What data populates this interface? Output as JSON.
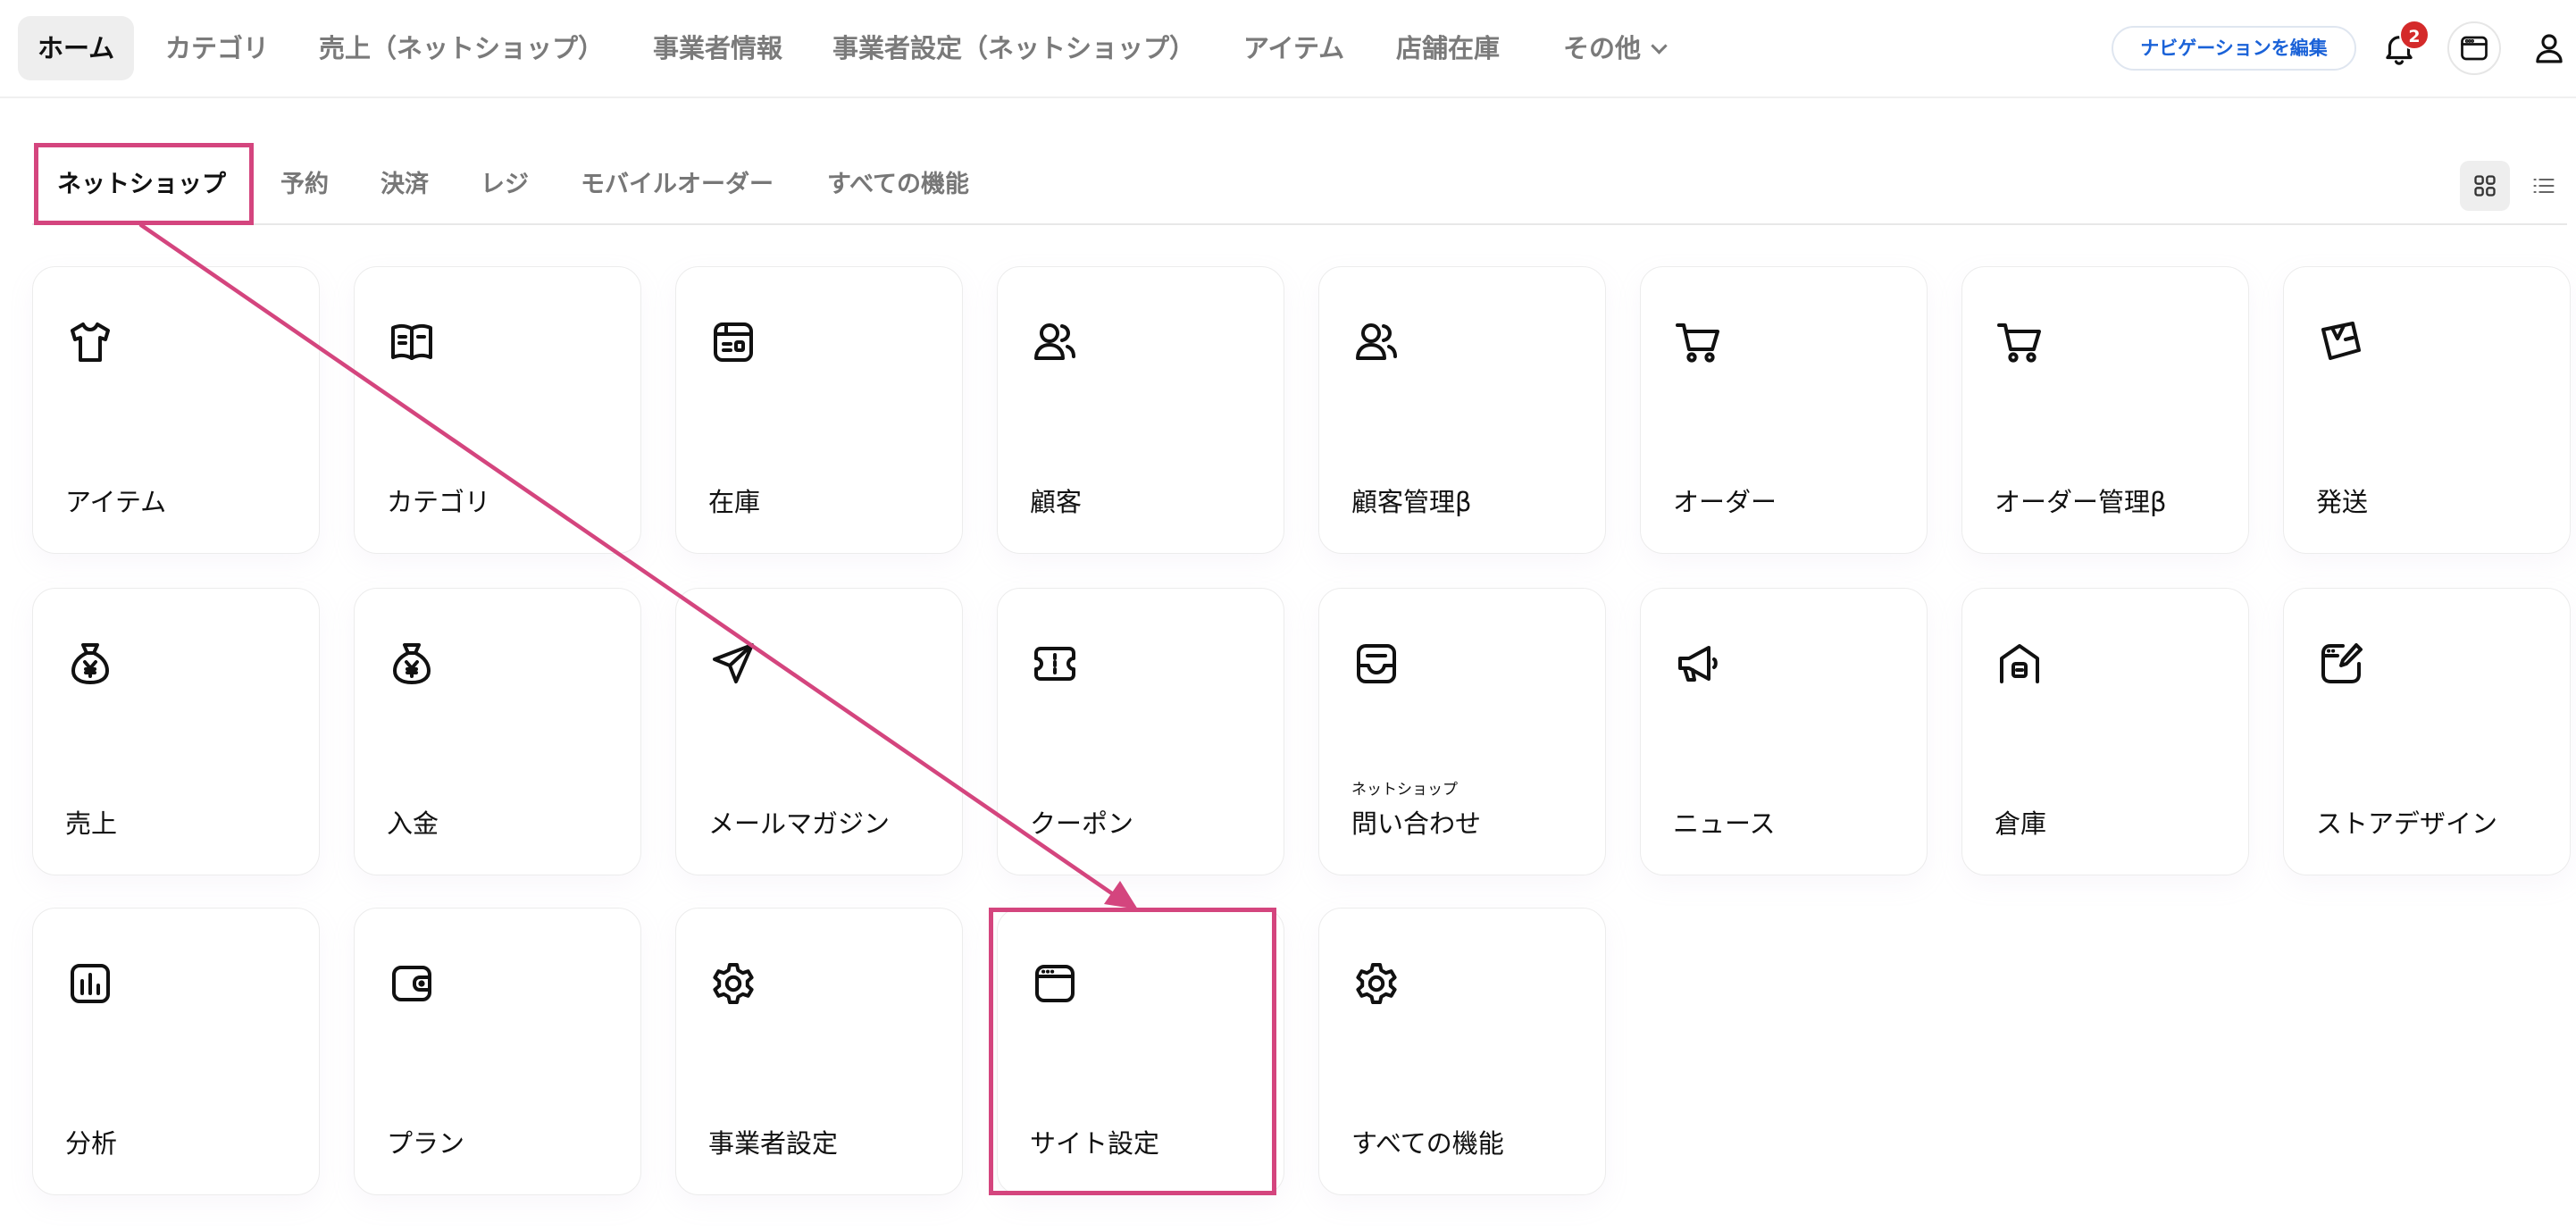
{
  "topnav": {
    "items": [
      {
        "label": "ホーム",
        "active": true
      },
      {
        "label": "カテゴリ"
      },
      {
        "label": "売上（ネットショップ）"
      },
      {
        "label": "事業者情報"
      },
      {
        "label": "事業者設定（ネットショップ）"
      },
      {
        "label": "アイテム"
      },
      {
        "label": "店舗在庫"
      },
      {
        "label": "その他"
      }
    ],
    "edit_nav_label": "ナビゲーションを編集",
    "notification_count": "2",
    "icons": [
      "bell-icon",
      "site-window-icon",
      "user-icon"
    ]
  },
  "subtabs": {
    "items": [
      {
        "label": "ネットショップ",
        "active": true
      },
      {
        "label": "予約"
      },
      {
        "label": "決済"
      },
      {
        "label": "レジ"
      },
      {
        "label": "モバイルオーダー"
      },
      {
        "label": "すべての機能"
      }
    ],
    "view_modes": [
      "grid-view-icon",
      "list-view-icon"
    ],
    "selected_view": "grid"
  },
  "tiles": [
    {
      "label": "アイテム",
      "icon": "tshirt-icon"
    },
    {
      "label": "カテゴリ",
      "icon": "book-icon"
    },
    {
      "label": "在庫",
      "icon": "inventory-icon"
    },
    {
      "label": "顧客",
      "icon": "customers-icon"
    },
    {
      "label": "顧客管理β",
      "icon": "customers-icon"
    },
    {
      "label": "オーダー",
      "icon": "cart-icon"
    },
    {
      "label": "オーダー管理β",
      "icon": "cart-icon"
    },
    {
      "label": "発送",
      "icon": "package-icon"
    },
    {
      "label": "売上",
      "icon": "money-bag-icon"
    },
    {
      "label": "入金",
      "icon": "money-bag-icon"
    },
    {
      "label": "メールマガジン",
      "icon": "paper-plane-icon"
    },
    {
      "label": "クーポン",
      "icon": "ticket-icon"
    },
    {
      "label": "問い合わせ",
      "sublabel": "ネットショップ",
      "icon": "inbox-icon"
    },
    {
      "label": "ニュース",
      "icon": "megaphone-icon"
    },
    {
      "label": "倉庫",
      "icon": "warehouse-icon"
    },
    {
      "label": "ストアデザイン",
      "icon": "design-edit-icon"
    },
    {
      "label": "分析",
      "icon": "chart-icon"
    },
    {
      "label": "プラン",
      "icon": "wallet-icon"
    },
    {
      "label": "事業者設定",
      "icon": "gear-icon"
    },
    {
      "label": "サイト設定",
      "icon": "browser-window-icon"
    },
    {
      "label": "すべての機能",
      "icon": "gear-icon"
    }
  ],
  "annotation": {
    "color": "#d4457e",
    "from": "ネットショップ",
    "to": "サイト設定"
  }
}
